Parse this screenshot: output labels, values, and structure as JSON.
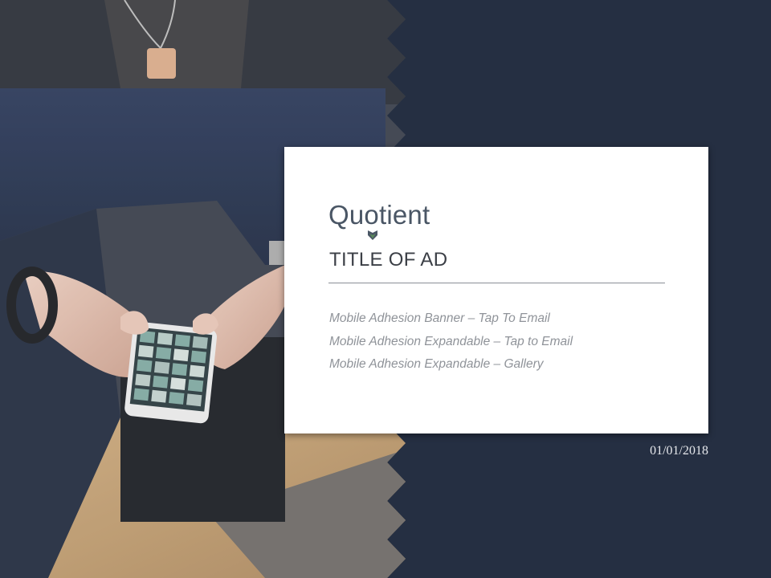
{
  "slide": {
    "logo_text": "Quotient",
    "title": "TITLE OF AD",
    "items": [
      "Mobile Adhesion Banner – Tap To Email",
      "Mobile Adhesion Expandable – Tap to Email",
      "Mobile Adhesion Expandable – Gallery"
    ],
    "date": "01/01/2018"
  },
  "colors": {
    "background_navy": "#252f42",
    "card": "#ffffff",
    "logo_gray": "#4a5665",
    "logo_mark_green": "#5a8a5a"
  },
  "icons": {
    "logo_mark": "shield-check-icon"
  }
}
